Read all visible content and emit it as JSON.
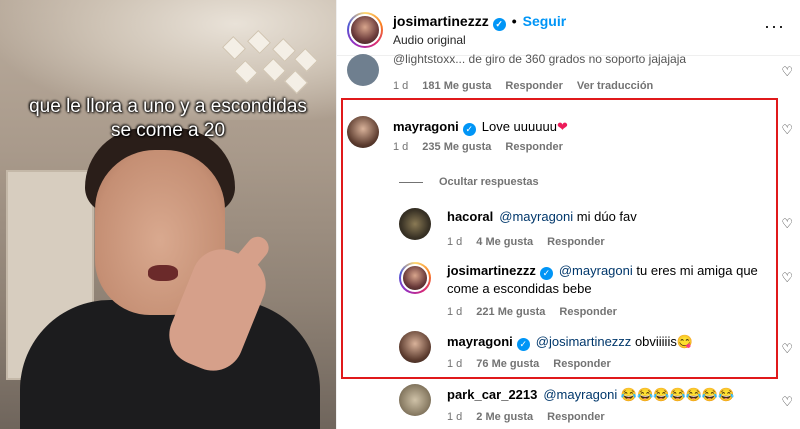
{
  "video": {
    "caption": "que le llora a uno y a escondidas se come a 20"
  },
  "header": {
    "username": "josimartinezzz",
    "separator": "•",
    "follow_label": "Seguir",
    "subtitle": "Audio original",
    "more_label": "···"
  },
  "comments": [
    {
      "username": "",
      "text": "@lightstoxx... de giro de 360 grados no soporto jajajaja",
      "time": "1 d",
      "likes": "181 Me gusta",
      "reply": "Responder",
      "translate": "Ver traducción"
    },
    {
      "username": "mayragoni",
      "text": "Love uuuuuu",
      "emoji": "❤",
      "time": "1 d",
      "likes": "235 Me gusta",
      "reply": "Responder"
    },
    {
      "username": "hacoral",
      "mention": "@mayragoni",
      "text": "mi dúo fav",
      "time": "1 d",
      "likes": "4 Me gusta",
      "reply": "Responder"
    },
    {
      "username": "josimartinezzz",
      "mention": "@mayragoni",
      "text": "tu eres mi amiga que",
      "text2": "come a escondidas bebe",
      "time": "1 d",
      "likes": "221 Me gusta",
      "reply": "Responder"
    },
    {
      "username": "mayragoni",
      "mention": "@josimartinezzz",
      "text": "obviiiiis",
      "emoji": "😋",
      "time": "1 d",
      "likes": "76 Me gusta",
      "reply": "Responder"
    },
    {
      "username": "park_car_2213",
      "mention": "@mayragoni",
      "emoji": "😂😂😂😂😂😂😂",
      "time": "1 d",
      "likes": "2 Me gusta",
      "reply": "Responder"
    }
  ],
  "hide_replies_label": "Ocultar respuestas",
  "heart_icon": "♡",
  "verified_icon": "✓",
  "colors": {
    "accent": "#0095f6",
    "highlight": "#e0191b",
    "meta": "#737373",
    "mention": "#00376b"
  }
}
